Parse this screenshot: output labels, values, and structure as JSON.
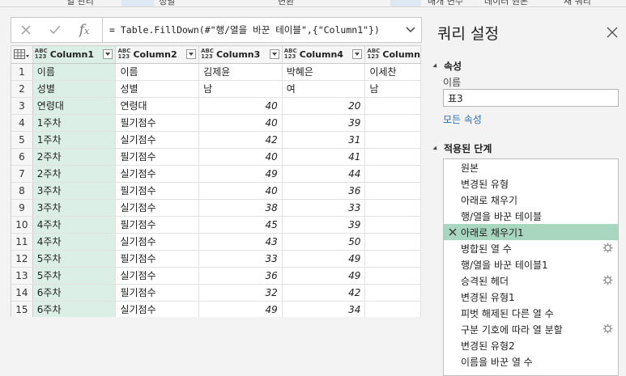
{
  "ribbon": {
    "labels": [
      "열 관리",
      "정렬",
      "변환",
      "매개 변수",
      "데이터 원본",
      "새 쿼리"
    ]
  },
  "formula": {
    "text": "= Table.FillDown(#\"행/열을 바꾼 테이블\",{\"Column1\"})"
  },
  "grid": {
    "type_label": "ABC\n123",
    "columns": [
      "Column1",
      "Column2",
      "Column3",
      "Column4",
      "Column"
    ],
    "rows": [
      [
        "이름",
        "이름",
        "김제윤",
        "박혜은",
        "이세찬"
      ],
      [
        "성별",
        "성별",
        "남",
        "여",
        "남"
      ],
      [
        "연령대",
        "연령대",
        "40",
        "20",
        ""
      ],
      [
        "1주차",
        "필기점수",
        "40",
        "39",
        ""
      ],
      [
        "1주차",
        "실기점수",
        "42",
        "31",
        ""
      ],
      [
        "2주차",
        "필기점수",
        "40",
        "41",
        ""
      ],
      [
        "2주차",
        "실기점수",
        "49",
        "44",
        ""
      ],
      [
        "3주차",
        "필기점수",
        "40",
        "36",
        ""
      ],
      [
        "3주차",
        "실기점수",
        "38",
        "33",
        ""
      ],
      [
        "4주차",
        "필기점수",
        "45",
        "39",
        ""
      ],
      [
        "4주차",
        "실기점수",
        "43",
        "50",
        ""
      ],
      [
        "5주차",
        "필기점수",
        "33",
        "49",
        ""
      ],
      [
        "5주차",
        "실기점수",
        "36",
        "49",
        ""
      ],
      [
        "6주차",
        "필기점수",
        "32",
        "42",
        ""
      ],
      [
        "6주차",
        "실기점수",
        "49",
        "34",
        ""
      ]
    ],
    "numeric_from_row": 3
  },
  "panel": {
    "title": "쿼리 설정",
    "properties_header": "속성",
    "name_label": "이름",
    "name_value": "표3",
    "all_properties_link": "모든 속성",
    "steps_header": "적용된 단계",
    "steps": [
      {
        "label": "원본",
        "gear": false,
        "selected": false
      },
      {
        "label": "변경된 유형",
        "gear": false,
        "selected": false
      },
      {
        "label": "아래로 채우기",
        "gear": false,
        "selected": false
      },
      {
        "label": "행/열을 바꾼 테이블",
        "gear": false,
        "selected": false
      },
      {
        "label": "아래로 채우기1",
        "gear": false,
        "selected": true
      },
      {
        "label": "병합된 열 수",
        "gear": true,
        "selected": false
      },
      {
        "label": "행/열을 바꾼 테이블1",
        "gear": false,
        "selected": false
      },
      {
        "label": "승격된 헤더",
        "gear": true,
        "selected": false
      },
      {
        "label": "변경된 유형1",
        "gear": false,
        "selected": false
      },
      {
        "label": "피벗 해제된 다른 열 수",
        "gear": false,
        "selected": false
      },
      {
        "label": "구분 기호에 따라 열 분할",
        "gear": true,
        "selected": false
      },
      {
        "label": "변경된 유형2",
        "gear": false,
        "selected": false
      },
      {
        "label": "이름을 바꾼 열 수",
        "gear": false,
        "selected": false
      }
    ]
  },
  "colors": {
    "selected_column": "#dcefe6",
    "selected_step": "#a9d6be",
    "link": "#2e6bb3"
  }
}
